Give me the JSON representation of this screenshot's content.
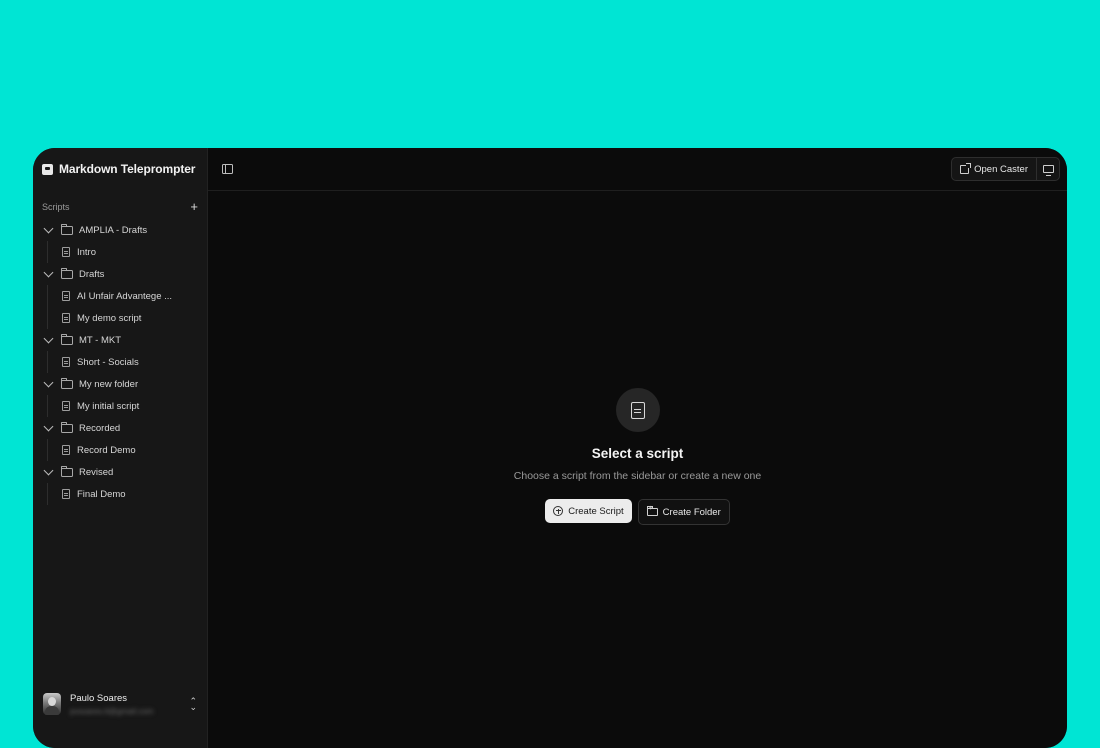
{
  "app": {
    "title": "Markdown Teleprompter"
  },
  "sidebar": {
    "section_label": "Scripts",
    "add_label": "+",
    "folders": [
      {
        "name": "AMPLIA - Drafts",
        "files": [
          "Intro"
        ]
      },
      {
        "name": "Drafts",
        "files": [
          "AI Unfair Advantege ...",
          "My demo script"
        ]
      },
      {
        "name": "MT - MKT",
        "files": [
          "Short - Socials"
        ]
      },
      {
        "name": "My new folder",
        "files": [
          "My initial script"
        ]
      },
      {
        "name": "Recorded",
        "files": [
          "Record Demo"
        ]
      },
      {
        "name": "Revised",
        "files": [
          "Final Demo"
        ]
      }
    ],
    "user": {
      "name": "Paulo Soares",
      "email": "pvsoares.lt@gmail.com"
    }
  },
  "topbar": {
    "open_caster_label": "Open Caster"
  },
  "empty_state": {
    "title": "Select a script",
    "subtitle": "Choose a script from the sidebar or create a new one",
    "create_script_label": "Create Script",
    "create_folder_label": "Create Folder"
  },
  "colors": {
    "background": "#00e5d4",
    "window": "#0b0b0b",
    "sidebar": "#171717"
  }
}
